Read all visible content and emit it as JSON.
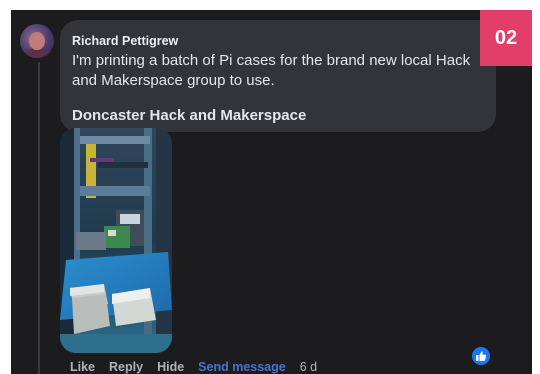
{
  "badge": {
    "number": "02",
    "color": "#e33d6c"
  },
  "comment": {
    "author": "Richard Pettigrew",
    "text": "I'm printing a batch of Pi cases for the brand new local Hack and Makerspace group to use.",
    "link_title": "Doncaster Hack and Makerspace"
  },
  "photo": {
    "description_icon": "photo-3d-printer"
  },
  "actions": {
    "like": "Like",
    "reply": "Reply",
    "hide": "Hide",
    "send_message": "Send message",
    "timestamp": "6 d"
  },
  "reaction": {
    "icon": "thumbs-up-icon",
    "color": "#1877f2"
  },
  "colors": {
    "background": "#1c1c1e",
    "bubble": "#333437",
    "link": "#4a72d6"
  }
}
